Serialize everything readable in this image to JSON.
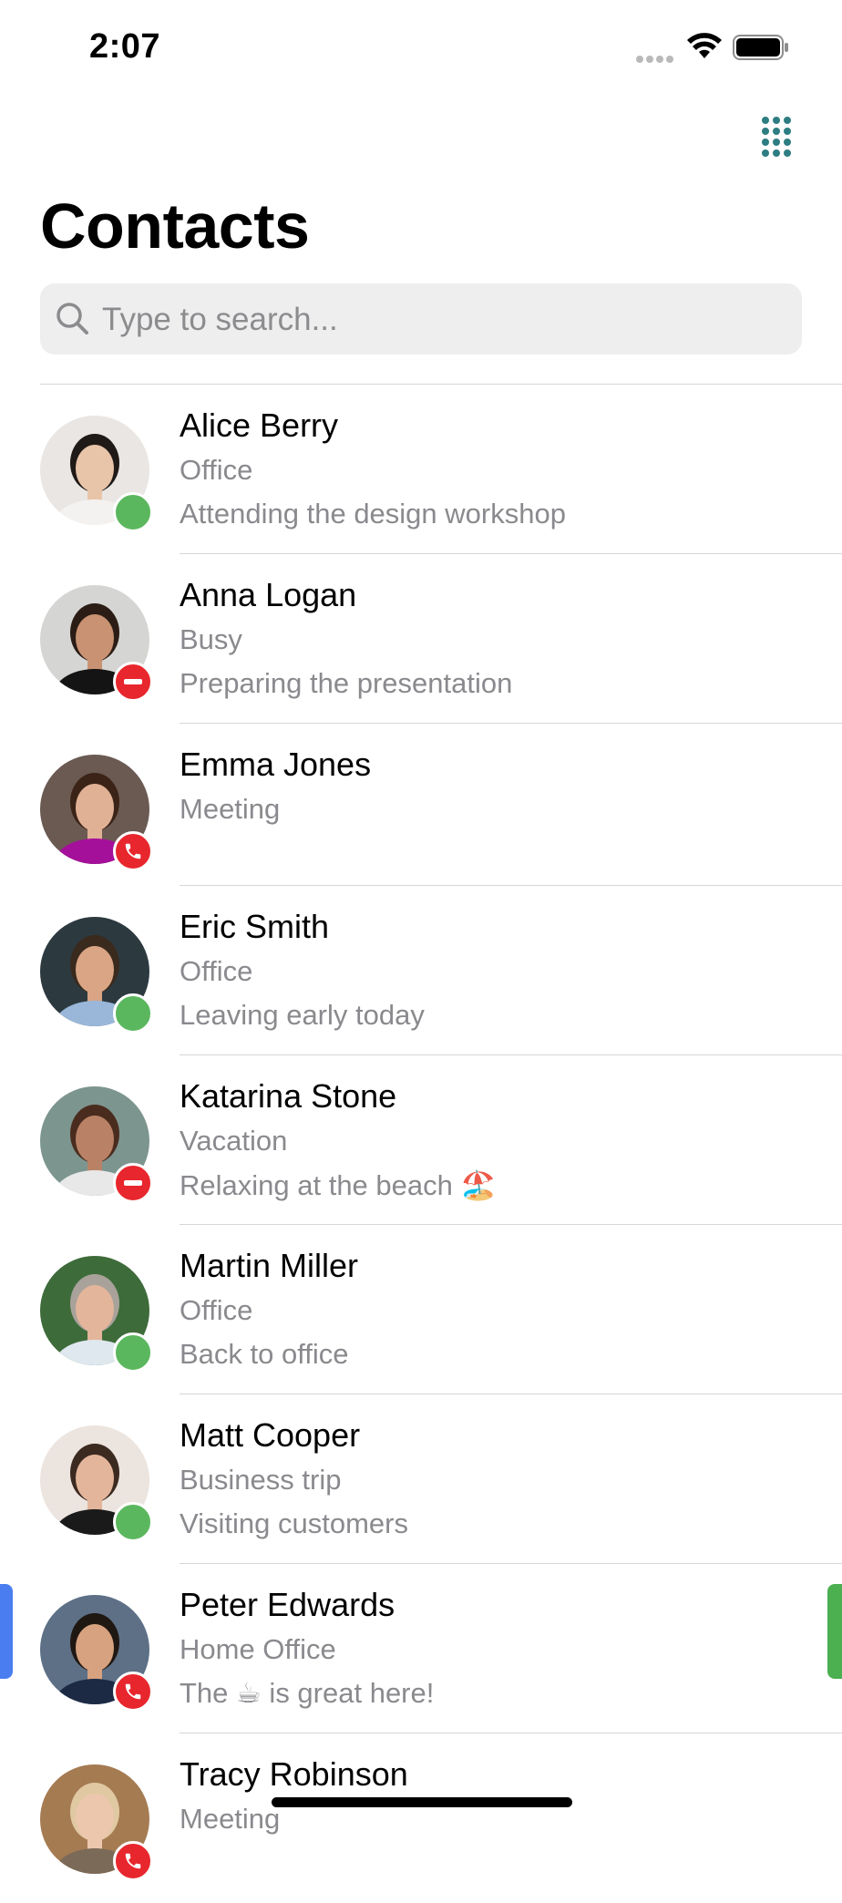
{
  "status_bar": {
    "time": "2:07"
  },
  "header": {
    "title": "Contacts"
  },
  "search": {
    "placeholder": "Type to search..."
  },
  "contacts": [
    {
      "name": "Alice Berry",
      "status": "Office",
      "note": "Attending the design workshop",
      "presence": "available"
    },
    {
      "name": "Anna Logan",
      "status": "Busy",
      "note": "Preparing the presentation",
      "presence": "busy"
    },
    {
      "name": "Emma Jones",
      "status": "Meeting",
      "note": "",
      "presence": "call"
    },
    {
      "name": "Eric Smith",
      "status": "Office",
      "note": "Leaving early today",
      "presence": "available"
    },
    {
      "name": "Katarina Stone",
      "status": "Vacation",
      "note": "Relaxing at the beach 🏖️",
      "presence": "busy"
    },
    {
      "name": "Martin Miller",
      "status": "Office",
      "note": "Back to office",
      "presence": "available"
    },
    {
      "name": "Matt Cooper",
      "status": "Business trip",
      "note": "Visiting customers",
      "presence": "available"
    },
    {
      "name": "Peter Edwards",
      "status": "Home Office",
      "note": "The ☕ is great here!",
      "presence": "call"
    },
    {
      "name": "Tracy Robinson",
      "status": "Meeting",
      "note": "",
      "presence": "call"
    }
  ],
  "colors": {
    "accent": "#2d7d82",
    "available": "#5bb75e",
    "busy": "#e8262d",
    "secondary_text": "#8a8a8e"
  }
}
